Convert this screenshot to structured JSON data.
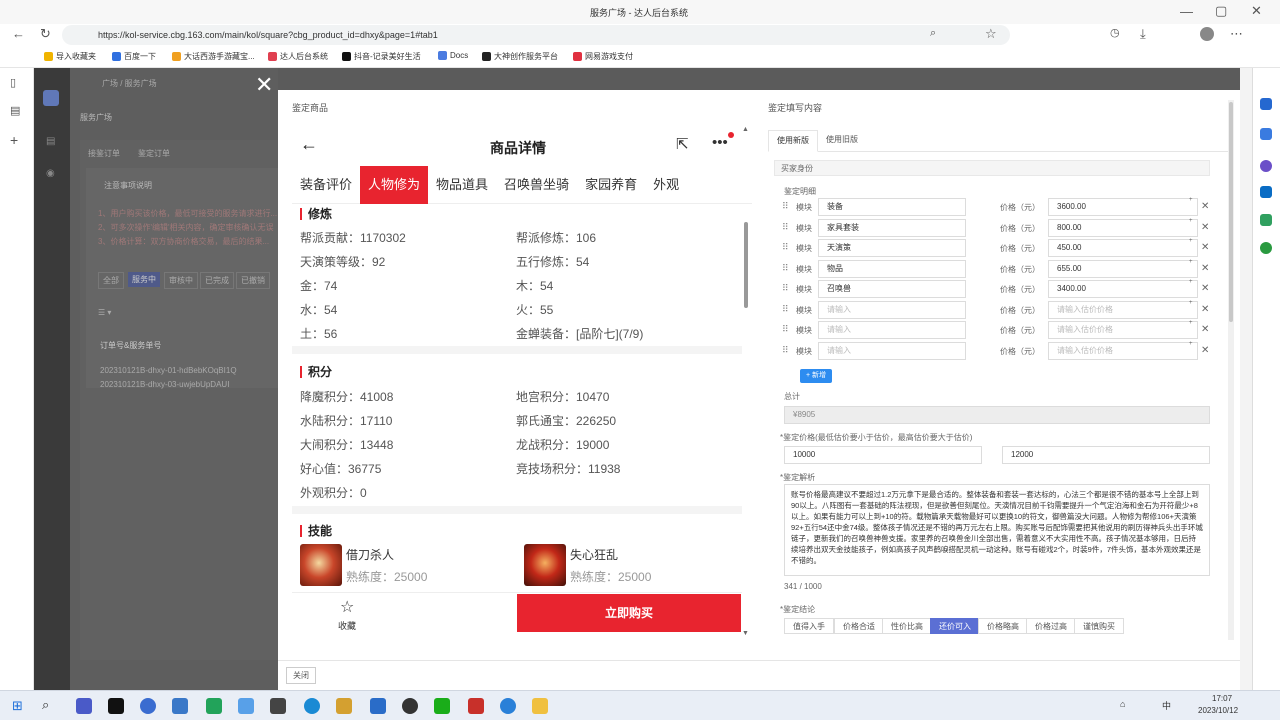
{
  "browser": {
    "tab_title": "服务广场 - 达人后台系统",
    "url": "https://kol-service.cbg.163.com/main/kol/square?cbg_product_id=dhxy&page=1#tab1",
    "bookmarks": [
      "导入收藏夹",
      "百度一下",
      "大话西游手游藏宝...",
      "达人后台系统",
      "抖音-记录美好生活",
      "Docs",
      "大神创作服务平台",
      "网易游戏支付"
    ]
  },
  "background_page": {
    "breadcrumb": "广场 / 服务广场",
    "page_title": "服务广场",
    "tabs": [
      "接鉴订单",
      "鉴定订单"
    ],
    "notice_title": "注意事项说明",
    "notices": [
      "1、用户购买该价格，最低可接受的服务请求进行...",
      "2、可多次操作'编辑'相关内容，确定审核确认无误",
      "3、价格计算：双方协商价格交易，最后的结果..."
    ],
    "filters": [
      "全部",
      "服务中",
      "审核中",
      "已完成",
      "已撤销"
    ],
    "col_header": "订单号&服务单号",
    "rows": [
      "202310121B-dhxy-01-hdBebKOqBI1Q",
      "202310121B-dhxy-03-uwjebUpDAUI"
    ]
  },
  "drawer": {
    "left_title": "鉴定商品",
    "right_title": "鉴定填写内容",
    "close_button": "关闭",
    "phone": {
      "title": "商品详情",
      "tabs": [
        "装备评价",
        "人物修为",
        "物品道具",
        "召唤兽坐骑",
        "家园养育",
        "外观"
      ],
      "active_tab": 1,
      "cultivation_title": "修炼",
      "cultivation": [
        [
          "帮派贡献：1170302",
          "帮派修炼：106"
        ],
        [
          "天演策等级：92",
          "五行修炼：54"
        ],
        [
          "金：74",
          "木：54"
        ],
        [
          "水：54",
          "火：55"
        ],
        [
          "土：56",
          "金蝉装备：[品阶七](7/9)"
        ]
      ],
      "points_title": "积分",
      "points": [
        [
          "降魔积分：41008",
          "地宫积分：10470"
        ],
        [
          "水陆积分：17110",
          "郭氏通宝：226250"
        ],
        [
          "大闹积分：13448",
          "龙战积分：19000"
        ],
        [
          "好心值：36775",
          "竞技场积分：11938"
        ],
        [
          "外观积分：0",
          ""
        ]
      ],
      "skills_title": "技能",
      "skills": [
        {
          "name": "借刀杀人",
          "level": "熟练度：25000"
        },
        {
          "name": "失心狂乱",
          "level": "熟练度：25000"
        }
      ],
      "favorite_label": "收藏",
      "buy_label": "立即购买"
    },
    "form": {
      "version_tabs": [
        "使用新版",
        "使用旧版"
      ],
      "buyer_section": "买家身份",
      "detail_label": "鉴定明细",
      "module_label": "模块",
      "price_label": "价格（元）",
      "rows": [
        {
          "module": "装备",
          "price": "3600.00"
        },
        {
          "module": "家具套装",
          "price": "800.00"
        },
        {
          "module": "天演策",
          "price": "450.00"
        },
        {
          "module": "物品",
          "price": "655.00"
        },
        {
          "module": "召唤兽",
          "price": "3400.00"
        },
        {
          "module": "",
          "price": ""
        },
        {
          "module": "",
          "price": ""
        },
        {
          "module": "",
          "price": ""
        }
      ],
      "module_placeholder": "请输入",
      "price_placeholder": "请输入估价价格",
      "add_button": "+ 新增",
      "total_label": "总计",
      "total_value": "¥8905",
      "range_label": "*鉴定价格(最低估价要小于估价，最高估价要大于估价)",
      "range_min": "10000",
      "range_max": "12000",
      "analysis_label": "*鉴定解析",
      "analysis_text": "账号价格最高建议不要超过1.2万元拿下是最合适的。整体装备和套装一套达标的，心法三个都是很不错的基本号上全部上到90以上。八阵图有一套基础的阵法视现，但是欲善但刻尾位。天演情况目前千钧需要提升一个气定泊海和金石为开符最少+8以上。如果有能力可以上到+10的符。载物篇承天载物最好可以更换10的符文，御兽篇没大问题。人物修为帮修106+天演策92+五行54还中金74级。整体孩子情况还是不错的再万元左右上限。购买账号后配饰需要把其他说用的刷历得神兵头出手环城链子，更新我们的召唤兽神兽支援。家里养的召唤兽金川全部出售，需着意义不大实用性不高。孩子情况基本够用，日后持续培养出双天金技能孩子，例如高孩子风声鹤唳搭配灵机一动这种。账号有碰戏2个，时装9件，7件头饰，基本外观效果还是不错的。",
      "char_count": "341 / 1000",
      "conclusion_label": "*鉴定结论",
      "conclusions": [
        "值得入手",
        "价格合适",
        "性价比高",
        "还价可入",
        "价格略高",
        "价格过高",
        "谨慎购买"
      ],
      "active_conclusion": 3
    }
  },
  "taskbar": {
    "time": "17:07",
    "date": "2023/10/12",
    "lang": "中"
  },
  "colors": {
    "accent_red": "#e8242f",
    "form_blue": "#5b6fd4",
    "add_blue": "#2d8cf0"
  }
}
